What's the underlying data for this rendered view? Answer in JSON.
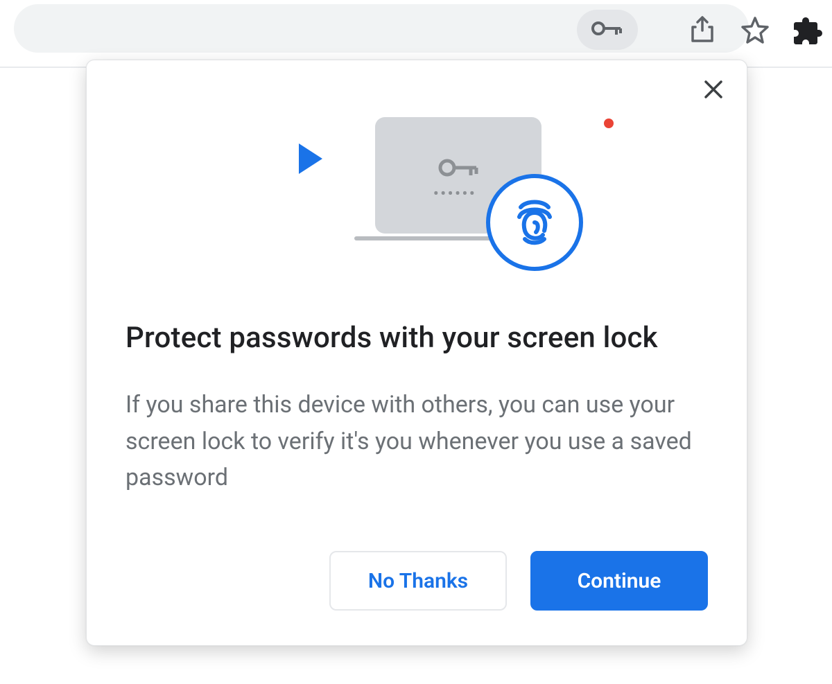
{
  "toolbar": {
    "icons": {
      "password_key": "key-icon",
      "share": "share-icon",
      "bookmark": "star-icon",
      "extensions": "puzzle-icon"
    }
  },
  "popup": {
    "close_label": "Close",
    "illustration": {
      "play": "play-icon",
      "dot": "red-dot",
      "key": "key-icon",
      "fingerprint": "fingerprint-icon"
    },
    "title": "Protect passwords with your screen lock",
    "body": "If you share this device with others, you can use your screen lock to verify it's you whenever you use a saved password",
    "buttons": {
      "secondary": "No Thanks",
      "primary": "Continue"
    }
  },
  "colors": {
    "accent": "#1a73e8",
    "text": "#202124",
    "muted": "#6b7075",
    "toolbar_bg": "#f1f3f4",
    "icon": "#5f6368",
    "danger": "#ea4335"
  }
}
